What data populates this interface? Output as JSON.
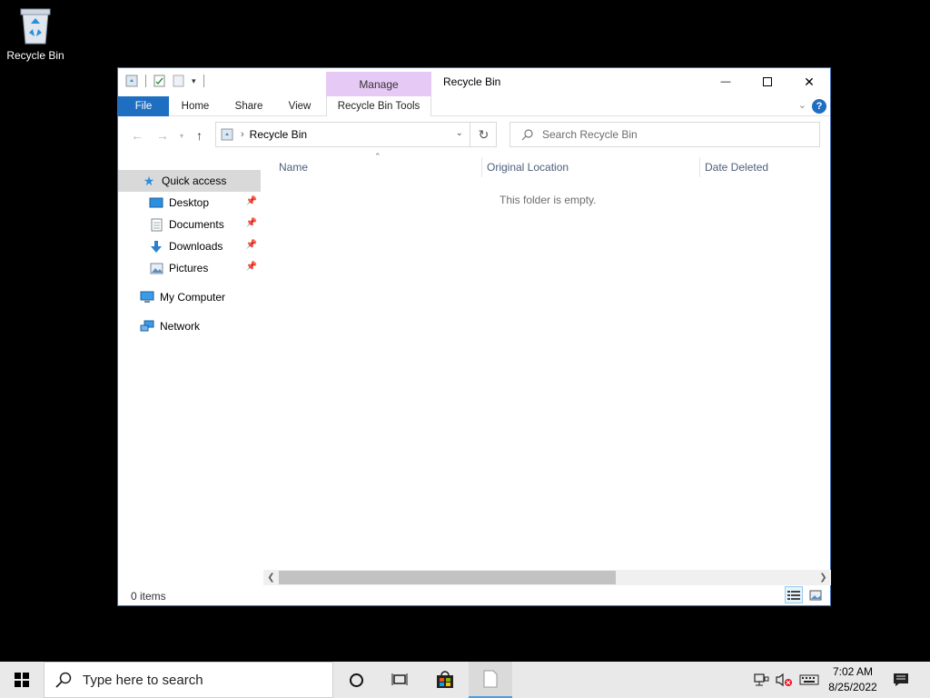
{
  "desktop": {
    "recycle_bin_label": "Recycle Bin"
  },
  "window": {
    "title": "Recycle Bin",
    "manage_tab": "Manage",
    "ribbon_tabs": {
      "file": "File",
      "home": "Home",
      "share": "Share",
      "view": "View",
      "tools": "Recycle Bin Tools"
    },
    "controls": {
      "minimize": "—",
      "maximize": "☐",
      "close": "✕"
    }
  },
  "address": {
    "breadcrumb": "Recycle Bin",
    "search_placeholder": "Search Recycle Bin"
  },
  "nav": {
    "quick_access": "Quick access",
    "items": [
      {
        "label": "Desktop"
      },
      {
        "label": "Documents"
      },
      {
        "label": "Downloads"
      },
      {
        "label": "Pictures"
      }
    ],
    "my_computer": "My Computer",
    "network": "Network"
  },
  "content": {
    "columns": {
      "name": "Name",
      "original_location": "Original Location",
      "date_deleted": "Date Deleted"
    },
    "empty_message": "This folder is empty."
  },
  "status": {
    "items": "0 items"
  },
  "taskbar": {
    "search_placeholder": "Type here to search",
    "time": "7:02 AM",
    "date": "8/25/2022"
  },
  "colors": {
    "accent": "#1e6fc1",
    "manage_tab": "#e7c9f5",
    "nav_selected": "#d9d9d9",
    "taskbar": "#e9e9e9"
  }
}
